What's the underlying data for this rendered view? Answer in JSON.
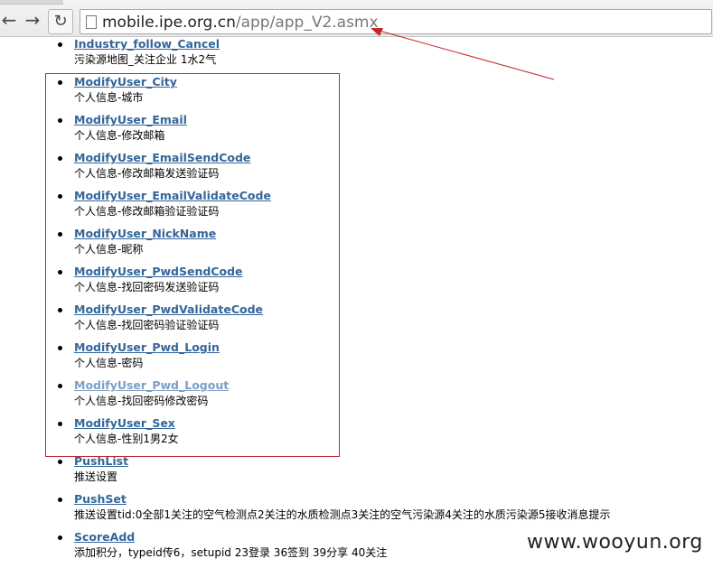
{
  "browser": {
    "url_host": "mobile.ipe.org.cn",
    "url_path": "/app/app_V2.asmx"
  },
  "methods": [
    {
      "name": "Industry_follow_Cancel",
      "desc": "污染源地图_关注企业 1水2气"
    },
    {
      "name": "ModifyUser_City",
      "desc": "个人信息-城市"
    },
    {
      "name": "ModifyUser_Email",
      "desc": "个人信息-修改邮箱"
    },
    {
      "name": "ModifyUser_EmailSendCode",
      "desc": "个人信息-修改邮箱发送验证码"
    },
    {
      "name": "ModifyUser_EmailValidateCode",
      "desc": "个人信息-修改邮箱验证验证码"
    },
    {
      "name": "ModifyUser_NickName",
      "desc": "个人信息-昵称"
    },
    {
      "name": "ModifyUser_PwdSendCode",
      "desc": "个人信息-找回密码发送验证码"
    },
    {
      "name": "ModifyUser_PwdValidateCode",
      "desc": "个人信息-找回密码验证验证码"
    },
    {
      "name": "ModifyUser_Pwd_Login",
      "desc": "个人信息-密码"
    },
    {
      "name": "ModifyUser_Pwd_Logout",
      "desc": "个人信息-找回密码修改密码"
    },
    {
      "name": "ModifyUser_Sex",
      "desc": "个人信息-性别1男2女"
    },
    {
      "name": "PushList",
      "desc": "推送设置"
    },
    {
      "name": "PushSet",
      "desc": "推送设置tid:0全部1关注的空气检测点2关注的水质检测点3关注的空气污染源4关注的水质污染源5接收消息提示"
    },
    {
      "name": "ScoreAdd",
      "desc": "添加积分，typeid传6，setupid 23登录 36签到 39分享 40关注"
    }
  ],
  "watermark": "www.wooyun.org",
  "colors": {
    "link": "#336699",
    "link_visited_faded": "#7b9fc4",
    "annotation_red": "#c0272d"
  }
}
